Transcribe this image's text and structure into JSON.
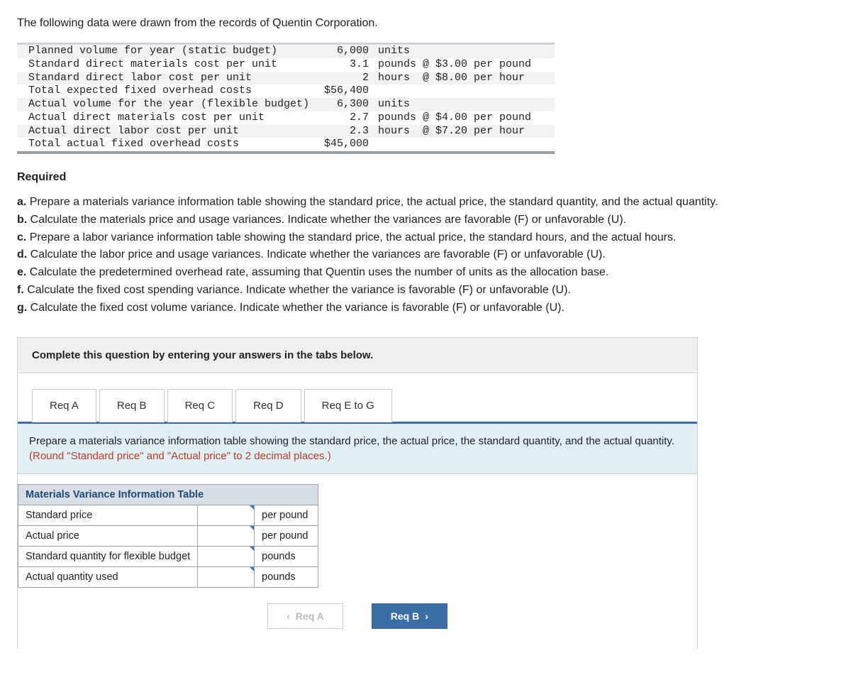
{
  "intro": "The following data were drawn from the records of Quentin Corporation.",
  "data_rows": [
    {
      "label": "Planned volume for year (static budget)",
      "q": "6,000",
      "unit": "units",
      "alt": true
    },
    {
      "label": "Standard direct materials cost per unit",
      "q": "3.1",
      "unit": "pounds @ $3.00 per pound",
      "alt": false
    },
    {
      "label": "Standard direct labor cost per unit",
      "q": "2",
      "unit": "hours  @ $8.00 per hour",
      "alt": true
    },
    {
      "label": "Total expected fixed overhead costs",
      "q": "$56,400",
      "unit": "",
      "alt": false
    },
    {
      "label": "Actual volume for the year (flexible budget)",
      "q": "6,300",
      "unit": "units",
      "alt": true
    },
    {
      "label": "Actual direct materials cost per unit",
      "q": "2.7",
      "unit": "pounds @ $4.00 per pound",
      "alt": false
    },
    {
      "label": "Actual direct labor cost per unit",
      "q": "2.3",
      "unit": "hours  @ $7.20 per hour",
      "alt": true
    },
    {
      "label": "Total actual fixed overhead costs",
      "q": "$45,000",
      "unit": "",
      "alt": false
    }
  ],
  "required_heading": "Required",
  "required_items": [
    {
      "b": "a.",
      "t": "Prepare a materials variance information table showing the standard price, the actual price, the standard quantity, and the actual quantity."
    },
    {
      "b": "b.",
      "t": "Calculate the materials price and usage variances. Indicate whether the variances are favorable (F) or unfavorable (U)."
    },
    {
      "b": "c.",
      "t": "Prepare a labor variance information table showing the standard price, the actual price, the standard hours, and the actual hours."
    },
    {
      "b": "d.",
      "t": "Calculate the labor price and usage variances. Indicate whether the variances are favorable (F) or unfavorable (U)."
    },
    {
      "b": "e.",
      "t": "Calculate the predetermined overhead rate, assuming that Quentin uses the number of units as the allocation base."
    },
    {
      "b": "f.",
      "t": "Calculate the fixed cost spending variance. Indicate whether the variance is favorable (F) or unfavorable (U)."
    },
    {
      "b": "g.",
      "t": "Calculate the fixed cost volume variance. Indicate whether the variance is favorable (F) or unfavorable (U)."
    }
  ],
  "card_instruction": "Complete this question by entering your answers in the tabs below.",
  "tabs": [
    "Req A",
    "Req B",
    "Req C",
    "Req D",
    "Req E to G"
  ],
  "tab_prompt_main": "Prepare a materials variance information table showing the standard price, the actual price, the standard quantity, and the actual quantity. ",
  "tab_prompt_round": "(Round \"Standard price\" and \"Actual price\" to 2 decimal places.)",
  "answer_table": {
    "header": "Materials Variance Information Table",
    "rows": [
      {
        "label": "Standard price",
        "unit": "per pound"
      },
      {
        "label": "Actual price",
        "unit": "per pound"
      },
      {
        "label": "Standard quantity for flexible budget",
        "unit": "pounds"
      },
      {
        "label": "Actual quantity used",
        "unit": "pounds"
      }
    ]
  },
  "nav": {
    "prev": "Req A",
    "next": "Req B"
  }
}
